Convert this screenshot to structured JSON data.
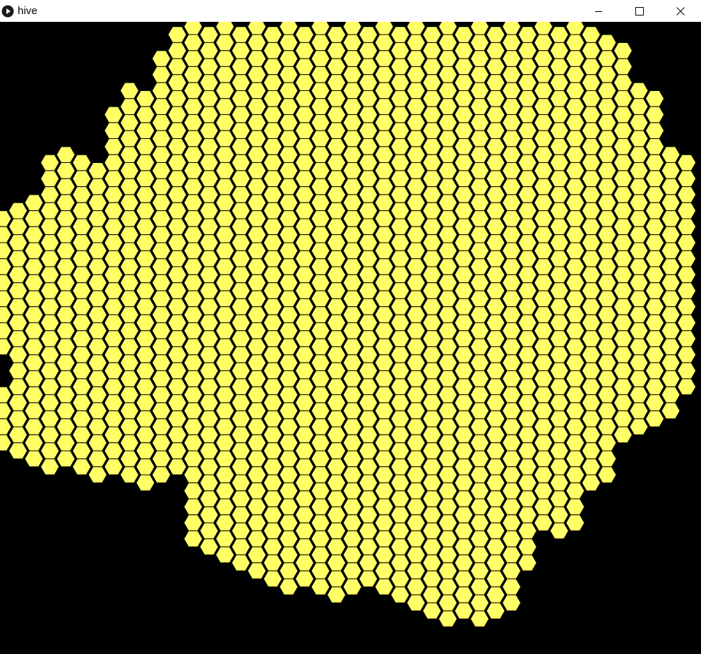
{
  "window": {
    "title": "hive",
    "app_icon": "processing-play-icon",
    "controls": [
      "minimize-icon",
      "maximize-icon",
      "close-icon"
    ]
  },
  "canvas": {
    "background_color": "#000000",
    "cell_fill_color": "#ffff66",
    "cell_stroke_color": "#000000",
    "cell_shape": "hexagon (flat-top)"
  }
}
